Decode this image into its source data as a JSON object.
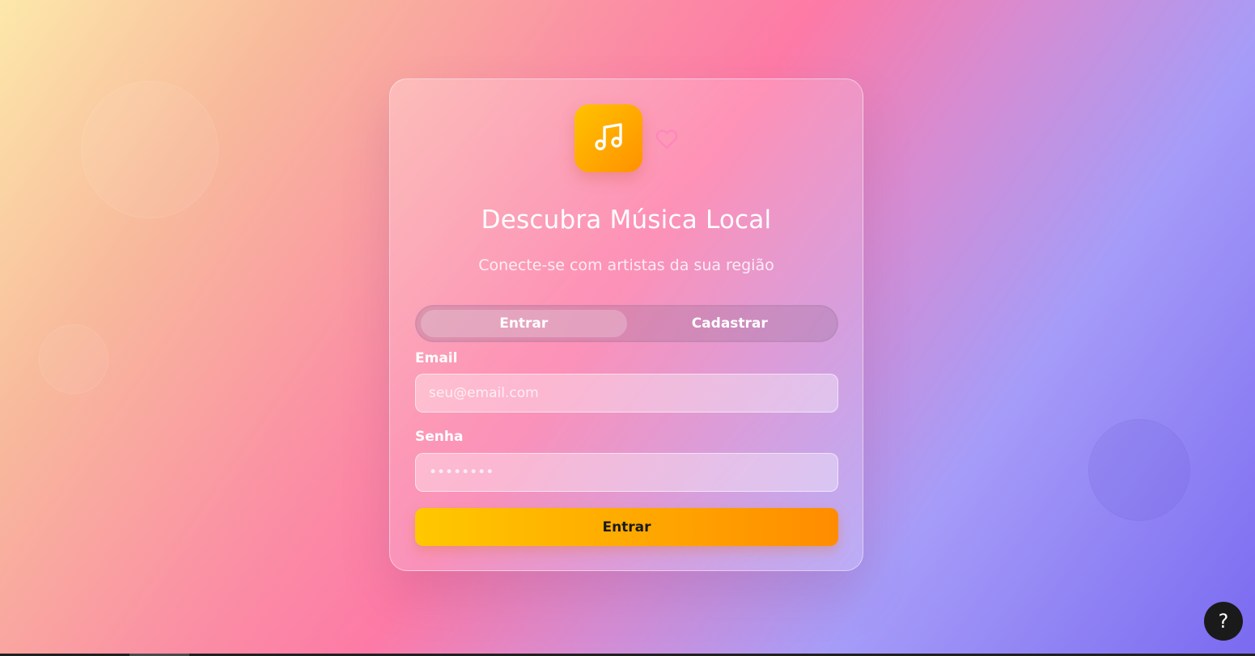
{
  "card": {
    "title": "Descubra Música Local",
    "subtitle": "Conecte-se com artistas da sua região"
  },
  "icons": {
    "logo": "music-note-icon",
    "decoration": "heart-icon",
    "help": "help-icon"
  },
  "tabs": [
    {
      "label": "Entrar",
      "active": true
    },
    {
      "label": "Cadastrar",
      "active": false
    }
  ],
  "form": {
    "email_label": "Email",
    "email_placeholder": "seu@email.com",
    "password_label": "Senha",
    "password_placeholder": "••••••••",
    "submit_label": "Entrar"
  },
  "help": {
    "label": "?"
  },
  "colors": {
    "accent_start": "#ffc800",
    "accent_end": "#ff8c00"
  }
}
